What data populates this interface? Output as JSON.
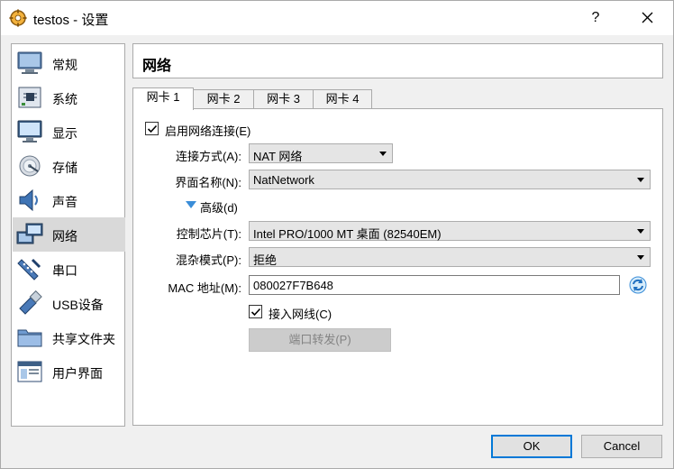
{
  "window": {
    "title": "testos - 设置",
    "help_label": "?"
  },
  "sidebar": {
    "items": [
      {
        "label": "常规",
        "icon": "general-icon"
      },
      {
        "label": "系统",
        "icon": "system-icon"
      },
      {
        "label": "显示",
        "icon": "display-icon"
      },
      {
        "label": "存储",
        "icon": "storage-icon"
      },
      {
        "label": "声音",
        "icon": "audio-icon"
      },
      {
        "label": "网络",
        "icon": "network-icon",
        "active": true
      },
      {
        "label": "串口",
        "icon": "serial-port-icon"
      },
      {
        "label": "USB设备",
        "icon": "usb-icon"
      },
      {
        "label": "共享文件夹",
        "icon": "shared-folder-icon"
      },
      {
        "label": "用户界面",
        "icon": "user-interface-icon"
      }
    ]
  },
  "page": {
    "title": "网络"
  },
  "tabs": [
    "网卡 1",
    "网卡 2",
    "网卡 3",
    "网卡 4"
  ],
  "adapter": {
    "enable_label": "启用网络连接(E)",
    "enable_checked": true,
    "attached_to_label": "连接方式(A):",
    "attached_to_value": "NAT 网络",
    "name_label": "界面名称(N):",
    "name_value": "NatNetwork",
    "advanced_label": "高级(d)",
    "adapter_type_label": "控制芯片(T):",
    "adapter_type_value": "Intel PRO/1000 MT 桌面 (82540EM)",
    "promiscuous_label": "混杂模式(P):",
    "promiscuous_value": "拒绝",
    "mac_label": "MAC 地址(M):",
    "mac_value": "080027F7B648",
    "cable_label": "接入网线(C)",
    "cable_checked": true,
    "port_forwarding_label": "端口转发(P)"
  },
  "footer": {
    "ok_label": "OK",
    "cancel_label": "Cancel"
  },
  "colors": {
    "accent": "#0078d7",
    "selected_item_bg": "#d9d9d9",
    "expander_arrow": "#3a8dd8"
  }
}
